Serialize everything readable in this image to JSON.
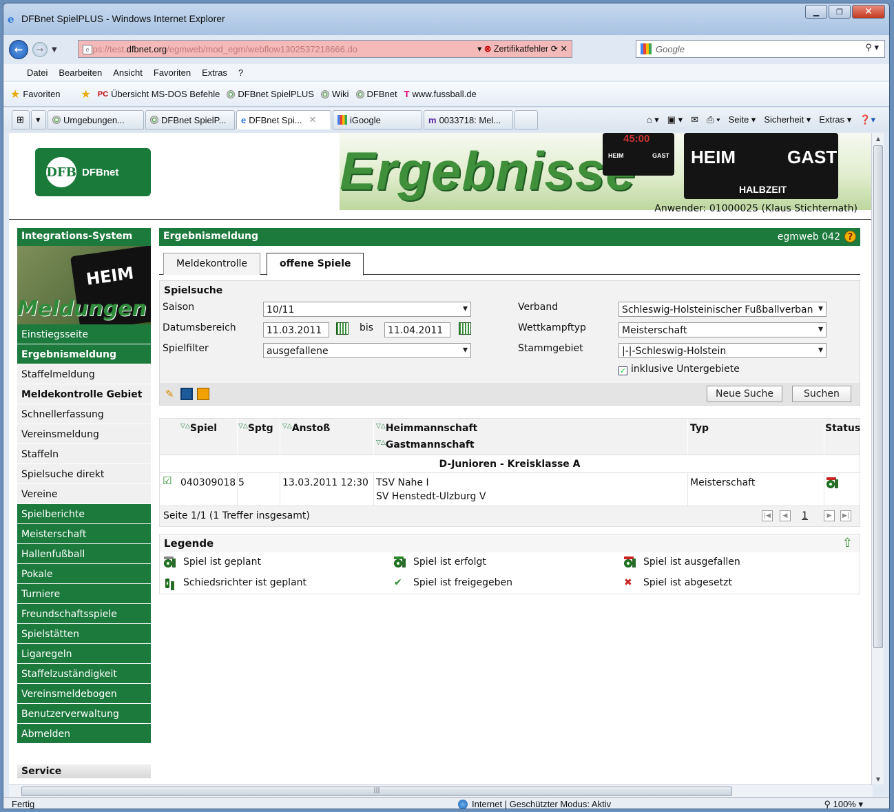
{
  "window": {
    "title": "DFBnet SpielPLUS - Windows Internet Explorer"
  },
  "address": {
    "url_prefix": "https://test.",
    "url_domain": "dfbnet.org",
    "url_path": "/egmweb/mod_egm/webflow1302537218666.do",
    "cert_error": "Zertifikatfehler",
    "search_placeholder": "Google"
  },
  "menu": [
    "Datei",
    "Bearbeiten",
    "Ansicht",
    "Favoriten",
    "Extras",
    "?"
  ],
  "favorites": {
    "label": "Favoriten",
    "items": [
      "Übersicht MS-DOS Befehle",
      "DFBnet SpielPLUS",
      "Wiki",
      "DFBnet",
      "www.fussball.de"
    ]
  },
  "browser_tabs": [
    "Umgebungen...",
    "DFBnet SpielP...",
    "DFBnet Spi...",
    "iGoogle",
    "0033718: Mel..."
  ],
  "commands": [
    "Seite ▾",
    "Sicherheit ▾",
    "Extras ▾"
  ],
  "header": {
    "logo_text": "DFBnet",
    "banner_title": "Ergebnisse",
    "board_heim": "HEIM",
    "board_gast": "GAST",
    "board_halbzeit": "HALBZEIT",
    "board_time": "45:00",
    "user": "Anwender: 01000025 (Klaus Stichternath)"
  },
  "sidebar": {
    "title": "Integrations-System",
    "image_word": "Meldungen",
    "image_heim": "HEIM",
    "items": [
      {
        "label": "Einstiegsseite",
        "style": "g"
      },
      {
        "label": "Ergebnismeldung",
        "style": "g b"
      },
      {
        "label": "Staffelmeldung",
        "style": "w"
      },
      {
        "label": "Meldekontrolle Gebiet",
        "style": "w b"
      },
      {
        "label": "Schnellerfassung",
        "style": "w"
      },
      {
        "label": "Vereinsmeldung",
        "style": "w"
      },
      {
        "label": "Staffeln",
        "style": "w"
      },
      {
        "label": "Spielsuche direkt",
        "style": "w"
      },
      {
        "label": "Vereine",
        "style": "w"
      },
      {
        "label": "Spielberichte",
        "style": "g"
      },
      {
        "label": "Meisterschaft",
        "style": "g"
      },
      {
        "label": "Hallenfußball",
        "style": "g"
      },
      {
        "label": "Pokale",
        "style": "g"
      },
      {
        "label": "Turniere",
        "style": "g"
      },
      {
        "label": "Freundschaftsspiele",
        "style": "g"
      },
      {
        "label": "Spielstätten",
        "style": "g"
      },
      {
        "label": "Ligaregeln",
        "style": "g"
      },
      {
        "label": "Staffelzuständigkeit",
        "style": "g"
      },
      {
        "label": "Vereinsmeldebogen",
        "style": "g"
      },
      {
        "label": "Benutzerverwaltung",
        "style": "g"
      },
      {
        "label": "Abmelden",
        "style": "g"
      }
    ],
    "service": "Service"
  },
  "main": {
    "title": "Ergebnismeldung",
    "version": "egmweb 042",
    "tabs": [
      "Meldekontrolle",
      "offene Spiele"
    ],
    "search": {
      "title": "Spielsuche",
      "saison_label": "Saison",
      "saison_value": "10/11",
      "datum_label": "Datumsbereich",
      "datum_from": "11.03.2011",
      "bis": "bis",
      "datum_to": "11.04.2011",
      "filter_label": "Spielfilter",
      "filter_value": "ausgefallene",
      "verband_label": "Verband",
      "verband_value": "Schleswig-Holsteinischer Fußballverban",
      "wettkampf_label": "Wettkampftyp",
      "wettkampf_value": "Meisterschaft",
      "stamm_label": "Stammgebiet",
      "stamm_value": "|-|-Schleswig-Holstein",
      "unter_label": "inklusive Untergebiete",
      "neue_suche": "Neue Suche",
      "suchen": "Suchen"
    },
    "table": {
      "headers": {
        "spiel": "Spiel",
        "sptg": "Sptg",
        "anstoss": "Anstoß",
        "heim": "Heimmannschaft",
        "gast": "Gastmannschaft",
        "typ": "Typ",
        "status": "Status"
      },
      "sort_marker": "▽△",
      "group": "D-Junioren - Kreisklasse A",
      "rows": [
        {
          "spiel": "040309018",
          "sptg": "5",
          "anstoss": "13.03.2011 12:30",
          "heim": "TSV Nahe I",
          "gast": "SV Henstedt-Ulzburg V",
          "typ": "Meisterschaft"
        }
      ],
      "pager_text": "Seite 1/1 (1 Treffer insgesamt)",
      "page": "1"
    },
    "legend": {
      "title": "Legende",
      "items": [
        "Spiel ist geplant",
        "Spiel ist erfolgt",
        "Spiel ist ausgefallen",
        "Schiedsrichter ist geplant",
        "Spiel ist freigegeben",
        "Spiel ist abgesetzt"
      ]
    }
  },
  "status": {
    "left": "Fertig",
    "zone": "Internet | Geschützter Modus: Aktiv",
    "zoom": "100%"
  },
  "colors": {
    "green": "#1c7a3c",
    "url_error": "#f4b9b9"
  }
}
